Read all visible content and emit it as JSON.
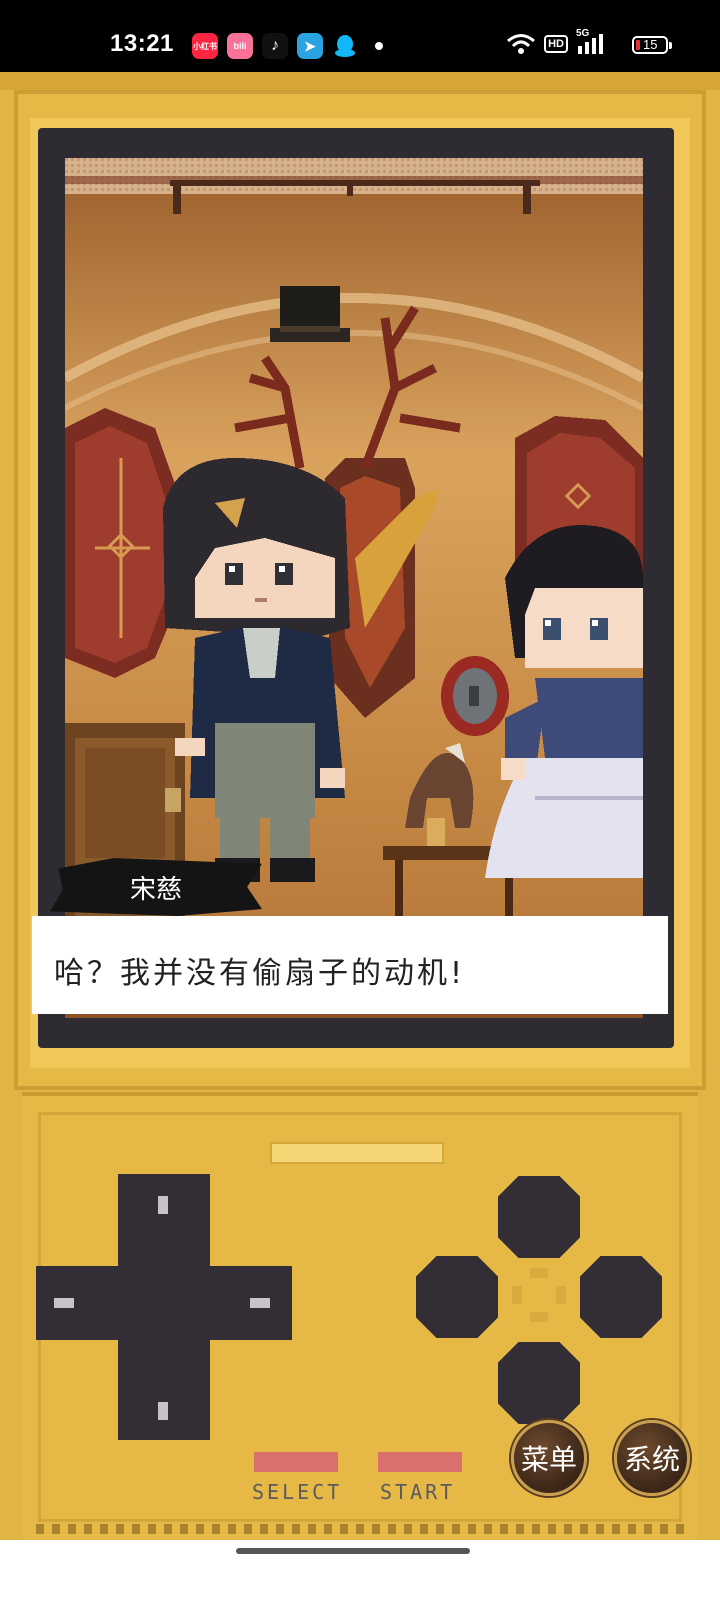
{
  "status_bar": {
    "time": "13:21",
    "apps": [
      {
        "icon": "xiaohongshu-icon",
        "label": "小红书",
        "color": "#ff2442"
      },
      {
        "icon": "bilibili-icon",
        "label": "bili",
        "color": "#fb7299"
      },
      {
        "icon": "tiktok-icon",
        "label": "♪",
        "color": "#111111"
      },
      {
        "icon": "telegram-icon",
        "label": "➤",
        "color": "#2aa3e0"
      },
      {
        "icon": "qq-icon",
        "label": "",
        "color": "#12b7f5"
      }
    ],
    "signal": {
      "hd": "HD",
      "network": "5G"
    },
    "battery_percent": "15"
  },
  "scene": {
    "speaker_name": "宋慈",
    "dialog_text": "哈？我并没有偷扇子的动机!"
  },
  "controls": {
    "select_label": "SELECT",
    "start_label": "START",
    "menu_label": "菜单",
    "system_label": "系统"
  },
  "colors": {
    "console": "#e6b947",
    "console_dark": "#c99b30",
    "bezel": "#2e2b33",
    "buttons": "#332e36",
    "select_start": "#d9706e"
  }
}
